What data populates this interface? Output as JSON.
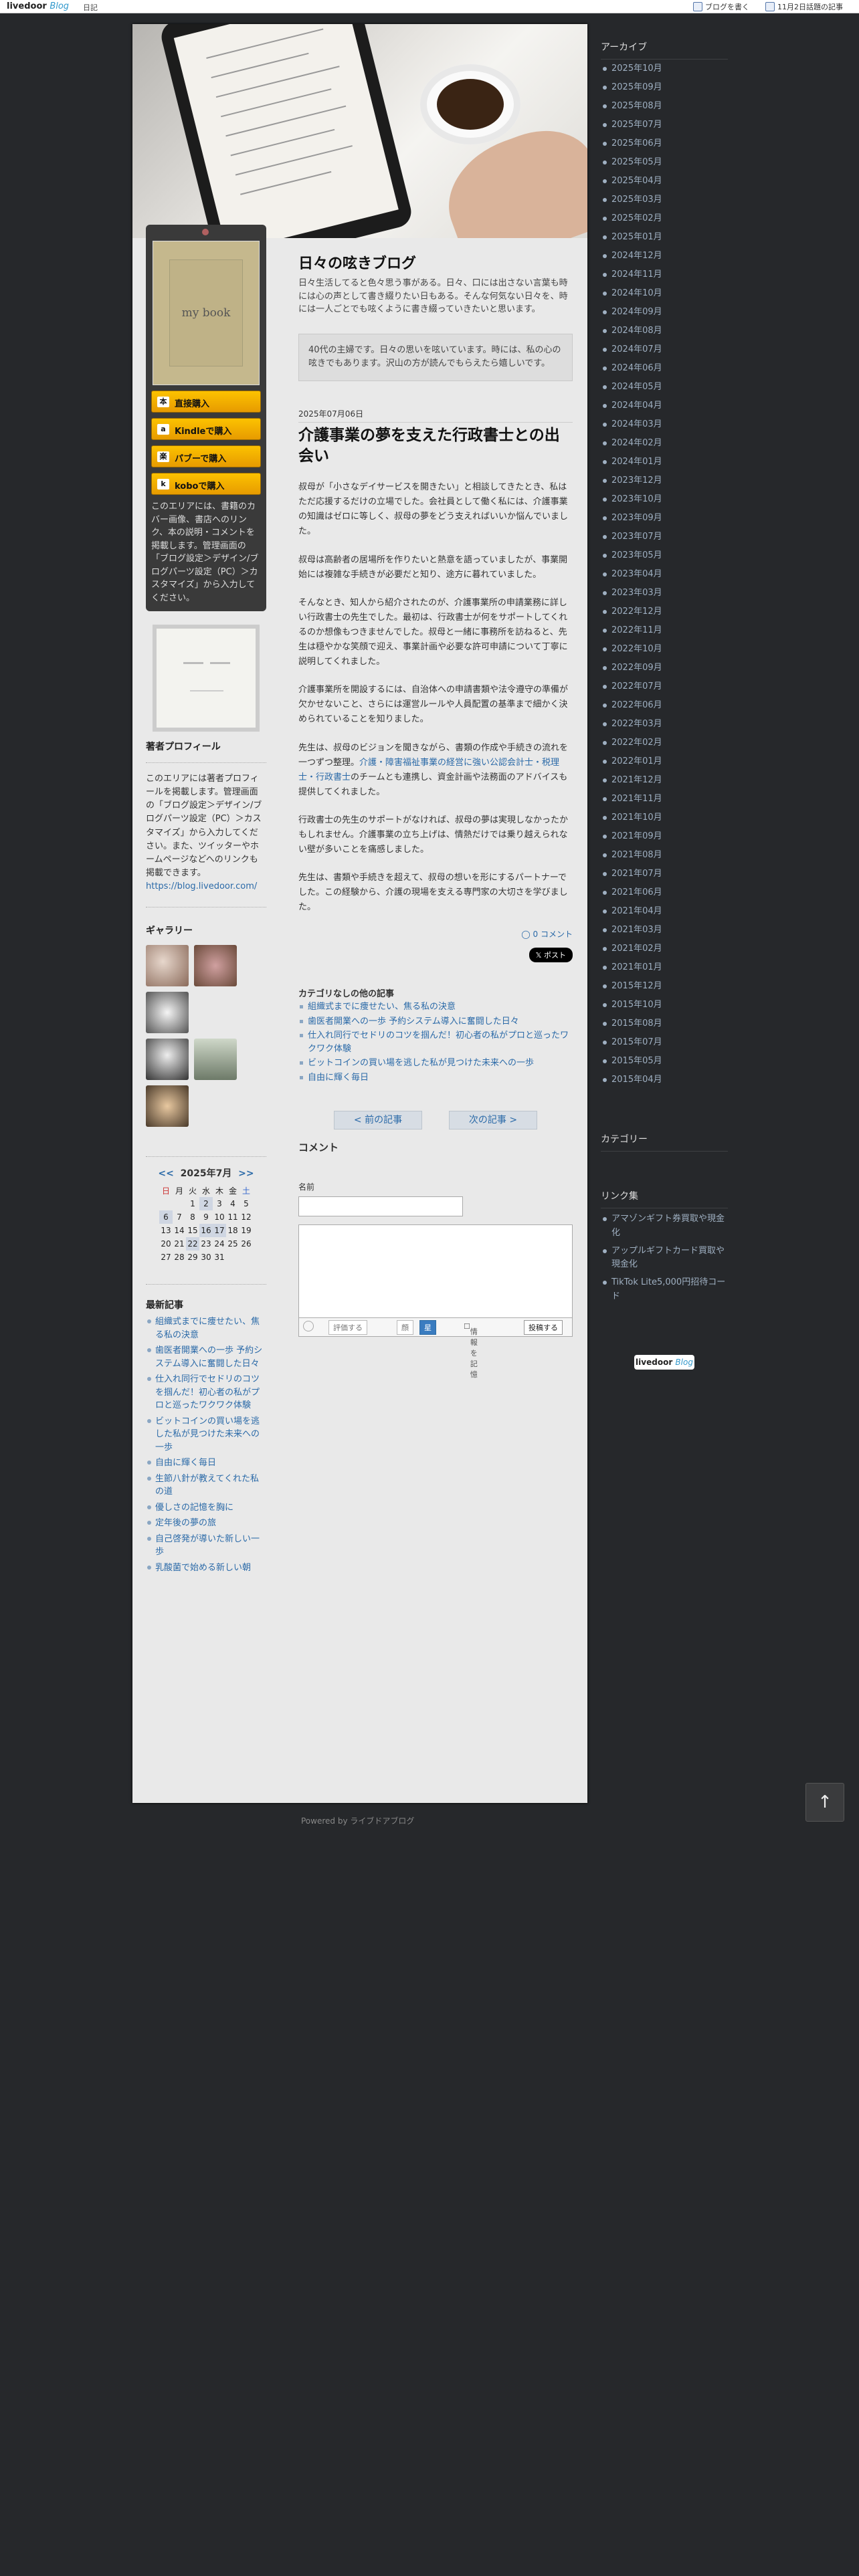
{
  "topbar": {
    "logo": "livedoor",
    "logo_blog": "Blog",
    "nav_diary": "日記",
    "write_link": "ブログを書く",
    "trending_link": "11月2日話題の記事"
  },
  "left": {
    "book_cover_text": "my book",
    "buy_buttons": [
      {
        "icon": "本",
        "label": "直接購入"
      },
      {
        "icon": "a",
        "label": "Kindleで購入"
      },
      {
        "icon": "楽",
        "label": "パブーで購入"
      },
      {
        "icon": "k",
        "label": "koboで購入"
      }
    ],
    "book_text": "このエリアには、書籍のカバー画像、書店へのリンク、本の説明・コメントを掲載します。管理画面の「ブログ設定＞デザイン/ブログパーツ設定（PC）＞カスタマイズ」から入力してください。",
    "profile_heading": "著者プロフィール",
    "profile_text": "このエリアには著者プロフィールを掲載します。管理画面の「ブログ設定＞デザイン/ブログパーツ設定（PC）＞カスタマイズ」から入力してください。また、ツイッターやホームページなどへのリンクも掲載できます。",
    "profile_link": "https://blog.livedoor.com/",
    "gallery_heading": "ギャラリー",
    "calendar": {
      "prev": "<<",
      "title": "2025年7月",
      "next": ">>",
      "weekdays": [
        "日",
        "月",
        "火",
        "水",
        "木",
        "金",
        "土"
      ],
      "rows": [
        [
          "",
          "",
          "1",
          "2",
          "3",
          "4",
          "5"
        ],
        [
          "6",
          "7",
          "8",
          "9",
          "10",
          "11",
          "12"
        ],
        [
          "13",
          "14",
          "15",
          "16",
          "17",
          "18",
          "19"
        ],
        [
          "20",
          "21",
          "22",
          "23",
          "24",
          "25",
          "26"
        ],
        [
          "27",
          "28",
          "29",
          "30",
          "31",
          "",
          ""
        ]
      ]
    },
    "recent_heading": "最新記事",
    "recent": [
      "組織式までに痩せたい、焦る私の決意",
      "歯医者開業への一歩 予約システム導入に奮闘した日々",
      "仕入れ同行でセドリのコツを掴んだ！初心者の私がプロと巡ったワクワク体験",
      "ビットコインの買い場を逃した私が見つけた未来への一歩",
      "自由に輝く毎日",
      "生節八針が教えてくれた私の道",
      "優しさの記憶を胸に",
      "定年後の夢の旅",
      "自己啓発が導いた新しい一歩",
      "乳酸菌で始める新しい朝"
    ]
  },
  "main": {
    "blog_title": "日々の呟きブログ",
    "blog_desc": "日々生活してると色々思う事がある。日々、口には出さない言葉も時には心の声として書き綴りたい日もある。そんな何気ない日々を、時には一人ごとでも呟くように書き綴っていきたいと思います。",
    "intro": "40代の主婦です。日々の思いを呟いています。時には、私の心の呟きでもあります。沢山の方が読んでもらえたら嬉しいです。",
    "article_date": "2025年07月06日",
    "article_title": "介護事業の夢を支えた行政書士との出会い",
    "paragraphs": [
      "叔母が「小さなデイサービスを開きたい」と相談してきたとき、私はただ応援するだけの立場でした。会社員として働く私には、介護事業の知識はゼロに等しく、叔母の夢をどう支えればいいか悩んでいました。",
      "叔母は高齢者の居場所を作りたいと熱意を語っていましたが、事業開始には複雑な手続きが必要だと知り、途方に暮れていました。",
      "そんなとき、知人から紹介されたのが、介護事業所の申請業務に詳しい行政書士の先生でした。最初は、行政書士が何をサポートしてくれるのか想像もつきませんでした。叔母と一緒に事務所を訪ねると、先生は穏やかな笑顔で迎え、事業計画や必要な許可申請について丁寧に説明してくれました。",
      "介護事業所を開設するには、自治体への申請書類や法令遵守の準備が欠かせないこと、さらには運営ルールや人員配置の基準まで細かく決められていることを知りました。"
    ],
    "p5_before": "先生は、叔母のビジョンを聞きながら、書類の作成や手続きの流れを一つずつ整理。",
    "p5_link": "介護・障害福祉事業の経営に強い公認会計士・税理士・行政書士",
    "p5_after": "のチームとも連携し、資金計画や法務面のアドバイスも提供してくれました。",
    "paragraphs_end": [
      "行政書士の先生のサポートがなければ、叔母の夢は実現しなかったかもしれません。介護事業の立ち上げは、情熱だけでは乗り越えられない壁が多いことを痛感しました。",
      "先生は、書類や手続きを超えて、叔母の想いを形にするパートナーでした。この経験から、介護の現場を支える専門家の大切さを学びました。"
    ],
    "comment_link": "0 コメント",
    "post_button": "ポスト",
    "other_heading": "カテゴリなしの他の記事",
    "other_articles": [
      "組織式までに痩せたい、焦る私の決意",
      "歯医者開業への一歩 予約システム導入に奮闘した日々",
      "仕入れ同行でセドリのコツを掴んだ！初心者の私がプロと巡ったワクワク体験",
      "ビットコインの買い場を逃した私が見つけた未来への一歩",
      "自由に輝く毎日"
    ],
    "prev_article": "< 前の記事",
    "next_article": "次の記事 >",
    "comments_heading": "コメント",
    "name_label": "名前",
    "rate_label": "評価する",
    "face_a": "顔",
    "face_b": "星",
    "remember_label": "情報を記憶",
    "submit_label": "投稿する"
  },
  "right": {
    "archive_heading": "アーカイブ",
    "archives": [
      "2025年10月",
      "2025年09月",
      "2025年08月",
      "2025年07月",
      "2025年06月",
      "2025年05月",
      "2025年04月",
      "2025年03月",
      "2025年02月",
      "2025年01月",
      "2024年12月",
      "2024年11月",
      "2024年10月",
      "2024年09月",
      "2024年08月",
      "2024年07月",
      "2024年06月",
      "2024年05月",
      "2024年04月",
      "2024年03月",
      "2024年02月",
      "2024年01月",
      "2023年12月",
      "2023年10月",
      "2023年09月",
      "2023年07月",
      "2023年05月",
      "2023年04月",
      "2023年03月",
      "2022年12月",
      "2022年11月",
      "2022年10月",
      "2022年09月",
      "2022年07月",
      "2022年06月",
      "2022年03月",
      "2022年02月",
      "2022年01月",
      "2021年12月",
      "2021年11月",
      "2021年10月",
      "2021年09月",
      "2021年08月",
      "2021年07月",
      "2021年06月",
      "2021年04月",
      "2021年03月",
      "2021年02月",
      "2021年01月",
      "2015年12月",
      "2015年10月",
      "2015年08月",
      "2015年07月",
      "2015年05月",
      "2015年04月"
    ],
    "category_heading": "カテゴリー",
    "links_heading": "リンク集",
    "links": [
      "アマゾンギフト券買取や現金化",
      "アップルギフトカード買取や現金化",
      "TikTok Lite5,000円招待コード"
    ]
  },
  "footer": {
    "badge_a": "livedoor",
    "badge_b": "Blog",
    "powered": "Powered by ライブドアブログ",
    "to_top": "↑"
  }
}
